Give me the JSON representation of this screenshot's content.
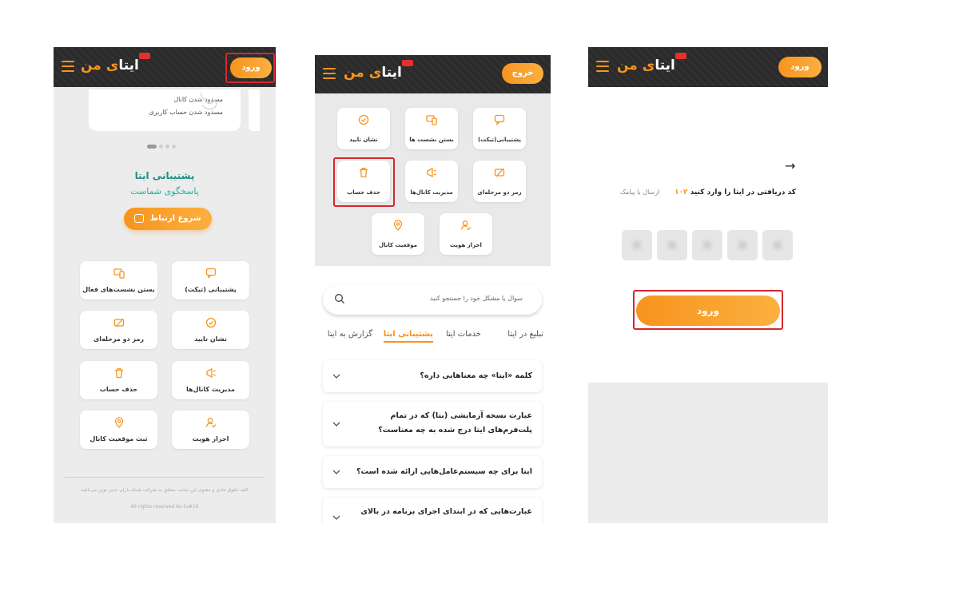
{
  "colors": {
    "accent": "#f7941d",
    "topbar": "#2b2b2b",
    "teal": "#1e8f86",
    "highlight": "#d7262e"
  },
  "logo": {
    "text_main": "ایتا",
    "text_accent": "ی من"
  },
  "screen1": {
    "login_button": "ورود",
    "carousel_lines": [
      "مسدود شدن کانال",
      "مسدود شدن حساب کاربری"
    ],
    "support_title": "پشتیبانی ایتا",
    "support_subtitle": "پاسخگوی شماست",
    "chat_button": "شروع ارتباط",
    "tiles": [
      {
        "label": "پشتیبانی (تیکت)",
        "icon": "chat-bubble-icon"
      },
      {
        "label": "بستن نشست‌های فعال",
        "icon": "devices-icon"
      },
      {
        "label": "نشان تایید",
        "icon": "verified-badge-icon"
      },
      {
        "label": "رمز دو مرحله‌ای",
        "icon": "password-icon"
      },
      {
        "label": "مدیریت کانال‌ها",
        "icon": "megaphone-icon"
      },
      {
        "label": "حذف حساب",
        "icon": "trash-icon"
      },
      {
        "label": "احراز هویت",
        "icon": "user-check-icon"
      },
      {
        "label": "ثبت موقعیت کانال",
        "icon": "location-pin-icon"
      }
    ],
    "footer_line1": "کلیه حقوق مادی و معنوی این سایت متعلق به شرکت شبکه یاران تدبیر نوین می‌باشد",
    "footer_line2": "All rights reserved Ku-tu#10"
  },
  "screen2": {
    "logout_button": "خروج",
    "tiles": [
      {
        "label": "پشتیبانی(تیکت)",
        "icon": "chat-bubble-icon"
      },
      {
        "label": "بستن نشست ها",
        "icon": "devices-icon"
      },
      {
        "label": "نشان تایید",
        "icon": "verified-badge-icon"
      },
      {
        "label": "رمز دو مرحله‌ای",
        "icon": "password-icon"
      },
      {
        "label": "مدیریت کانال‌ها",
        "icon": "megaphone-icon"
      },
      {
        "label": "حذف حساب",
        "icon": "trash-icon"
      },
      {
        "label": "احراز هویت",
        "icon": "user-check-icon"
      },
      {
        "label": "موقعیت کانال",
        "icon": "location-pin-icon"
      }
    ],
    "search_placeholder": "سوال یا مشکل خود را جستجو کنید",
    "tabs": [
      "تبلیغ در ایتا",
      "خدمات ایتا",
      "پشتیبانی ایتا",
      "گزارش به ایتا"
    ],
    "active_tab": "پشتیبانی ایتا",
    "faqs": [
      "کلمه «ایتا» چه معناهایی داره؟",
      "عبارت نسخه آزمایشی (بتا) که در تمام پلت‌فرم‌های ایتا درج شده به چه معناست؟",
      "ایتا برای چه سیستم‌عامل‌هایی ارائه شده است؟",
      "عبارت‌هایی که در ابتدای اجرای برنامه در بالای صفحه"
    ]
  },
  "screen3": {
    "login_button": "ورود",
    "back_arrow": "→",
    "code_prompt": "کد دریافتی در ایتا را وارد کنید",
    "code_placeholder": "۱۰۲",
    "sms_link": "ارسال با پیامک",
    "submit_button": "ورود",
    "otp_count": 5
  }
}
